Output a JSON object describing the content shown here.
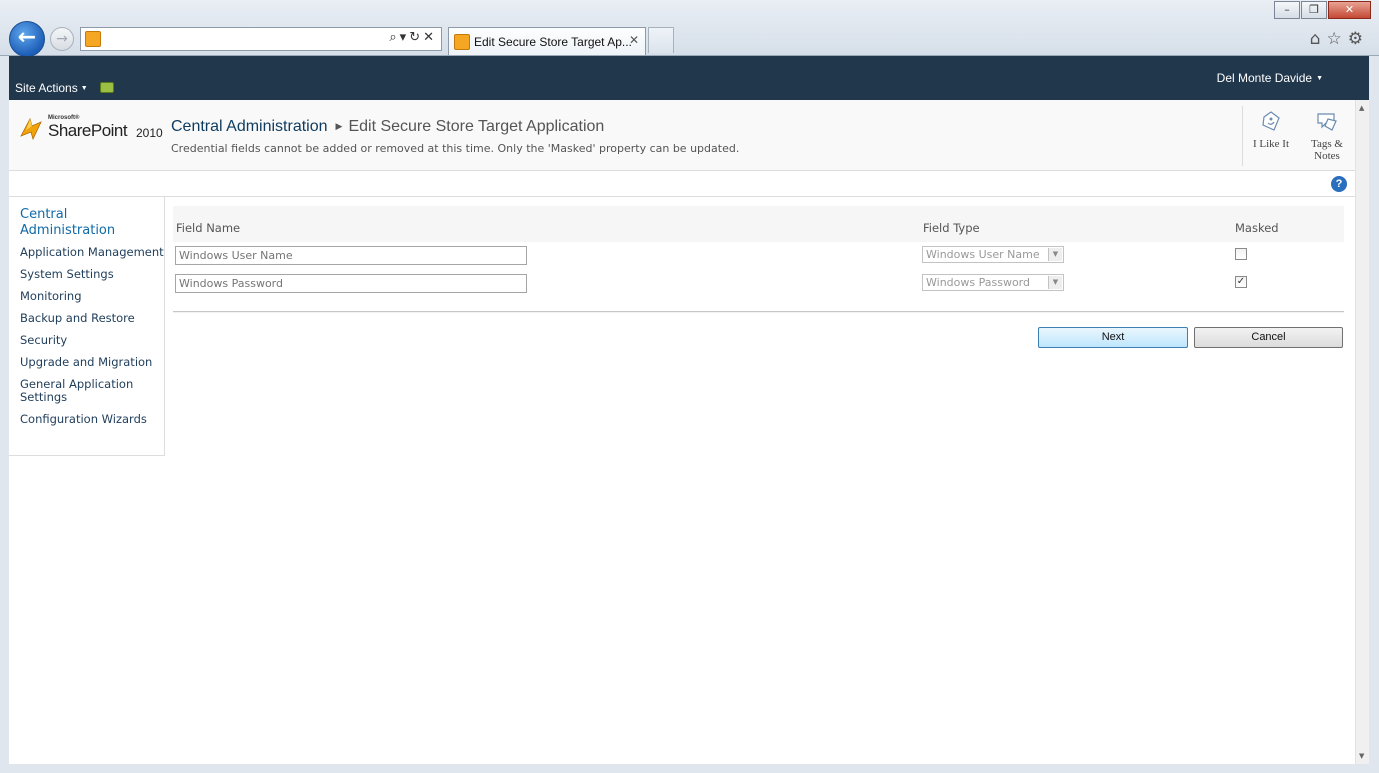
{
  "browser": {
    "tab_title": "Edit Secure Store Target Ap...",
    "close_glyph": "✕",
    "address_tools": "⌕▾↻✕"
  },
  "ribbon": {
    "site_actions_label": "Site Actions",
    "user_name": "Del Monte Davide"
  },
  "logo": {
    "vendor": "Microsoft®",
    "product": "SharePoint",
    "year": "2010"
  },
  "header": {
    "breadcrumb_root": "Central Administration",
    "breadcrumb_current": "Edit Secure Store Target Application",
    "description": "Credential fields cannot be added or removed at this time. Only the 'Masked' property can be updated."
  },
  "social": {
    "like_label": "I Like It",
    "tags_label_line1": "Tags &",
    "tags_label_line2": "Notes"
  },
  "help": {
    "glyph": "?"
  },
  "quick_launch": {
    "header": "Central Administration",
    "items": [
      "Application Management",
      "System Settings",
      "Monitoring",
      "Backup and Restore",
      "Security",
      "Upgrade and Migration",
      "General Application Settings",
      "Configuration Wizards"
    ]
  },
  "form": {
    "col_field_name": "Field Name",
    "col_field_type": "Field Type",
    "col_masked": "Masked",
    "rows": [
      {
        "name": "Windows User Name",
        "type": "Windows User Name",
        "masked": false,
        "masked_glyph": ""
      },
      {
        "name": "Windows Password",
        "type": "Windows Password",
        "masked": true,
        "masked_glyph": "✓"
      }
    ],
    "next_label": "Next",
    "cancel_label": "Cancel"
  },
  "colors": {
    "ribbon": "#21374c",
    "link": "#0f3b5f",
    "accent": "#0f6aa8"
  }
}
